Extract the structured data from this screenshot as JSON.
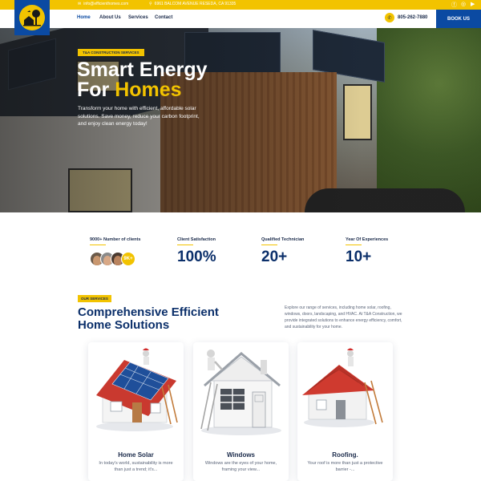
{
  "topbar": {
    "email": "info@efficienthomes.com",
    "address": "6961 BALCOM AVENUE RESEDA, CA 91335",
    "social": [
      "facebook-icon",
      "instagram-icon",
      "youtube-icon"
    ]
  },
  "nav": {
    "links": [
      "Home",
      "About Us",
      "Services",
      "Contact"
    ],
    "phone": "805-262-7880",
    "book_label": "BOOK US"
  },
  "hero": {
    "tag": "T&A CONSTRUCTION SERVICES",
    "title_line1": "Smart Energy",
    "title_line2_prefix": "For ",
    "title_line2_highlight": "Homes",
    "description": "Transform your home with efficient, affordable solar solutions. Save money, reduce your carbon footprint, and enjoy clean energy today!"
  },
  "stats": [
    {
      "label": "9000+ Number of clients",
      "avatar_count": "9K+"
    },
    {
      "label": "Client Satisfaction",
      "value": "100%"
    },
    {
      "label": "Qualified Technician",
      "value": "20+"
    },
    {
      "label": "Year Of Experiences",
      "value": "10+"
    }
  ],
  "services": {
    "tag": "OUR SERVICES",
    "heading_line1": "Comprehensive Efficient",
    "heading_line2": "Home Solutions",
    "intro": "Explore our range of services, including home solar, roofing, windows, doors, landscaping, and HVAC. At T&A Construction, we provide integrated solutions to enhance energy efficiency, comfort, and sustainability for your home.",
    "cards": [
      {
        "title": "Home Solar",
        "desc": "In today's world, sustainability is more than just a trend; it's..."
      },
      {
        "title": "Windows",
        "desc": "Windows are the eyes of your home, framing your view..."
      },
      {
        "title": "Roofing.",
        "desc": "Your roof is more than just a protective barrier -..."
      }
    ]
  },
  "colors": {
    "brand_blue": "#0b4aa2",
    "accent_yellow": "#f2c300",
    "heading_navy": "#0b2f6a"
  }
}
